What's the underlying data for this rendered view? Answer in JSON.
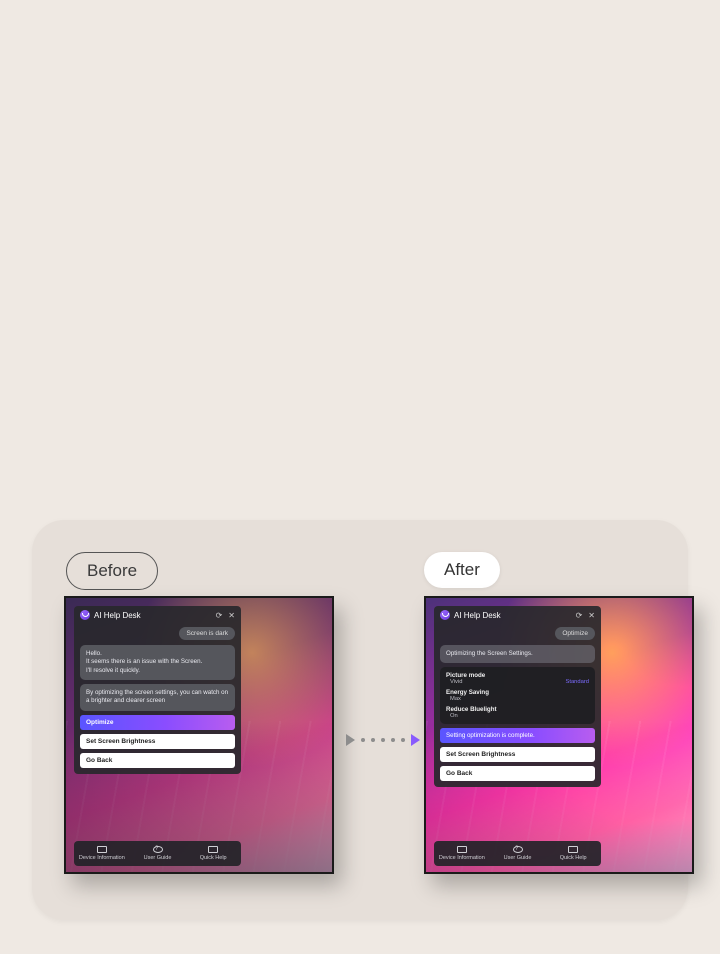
{
  "labels": {
    "before": "Before",
    "after": "After"
  },
  "panel": {
    "title": "AI Help Desk",
    "before": {
      "user_chip": "Screen is dark",
      "msg1": "Hello.\nIt seems there is an issue with the Screen.\nI'll resolve it quickly.",
      "msg2": "By optimizing the screen settings, you can watch on a brighter and clearer screen",
      "optimize": "Optimize",
      "set_brightness": "Set Screen Brightness",
      "go_back": "Go Back"
    },
    "after": {
      "user_chip": "Optimize",
      "progress": "Optimizing the Screen Settings.",
      "settings": {
        "picture_mode": {
          "label": "Picture mode",
          "value": "Vivid",
          "alt": "Standard"
        },
        "energy_saving": {
          "label": "Energy Saving",
          "value": "Max"
        },
        "reduce_bluelight": {
          "label": "Reduce Bluelight",
          "value": "On"
        }
      },
      "complete": "Setting optimization is complete.",
      "set_brightness": "Set Screen Brightness",
      "go_back": "Go Back"
    }
  },
  "toolbar": {
    "device_info": "Device Information",
    "user_guide": "User Guide",
    "quick_help": "Quick Help"
  }
}
